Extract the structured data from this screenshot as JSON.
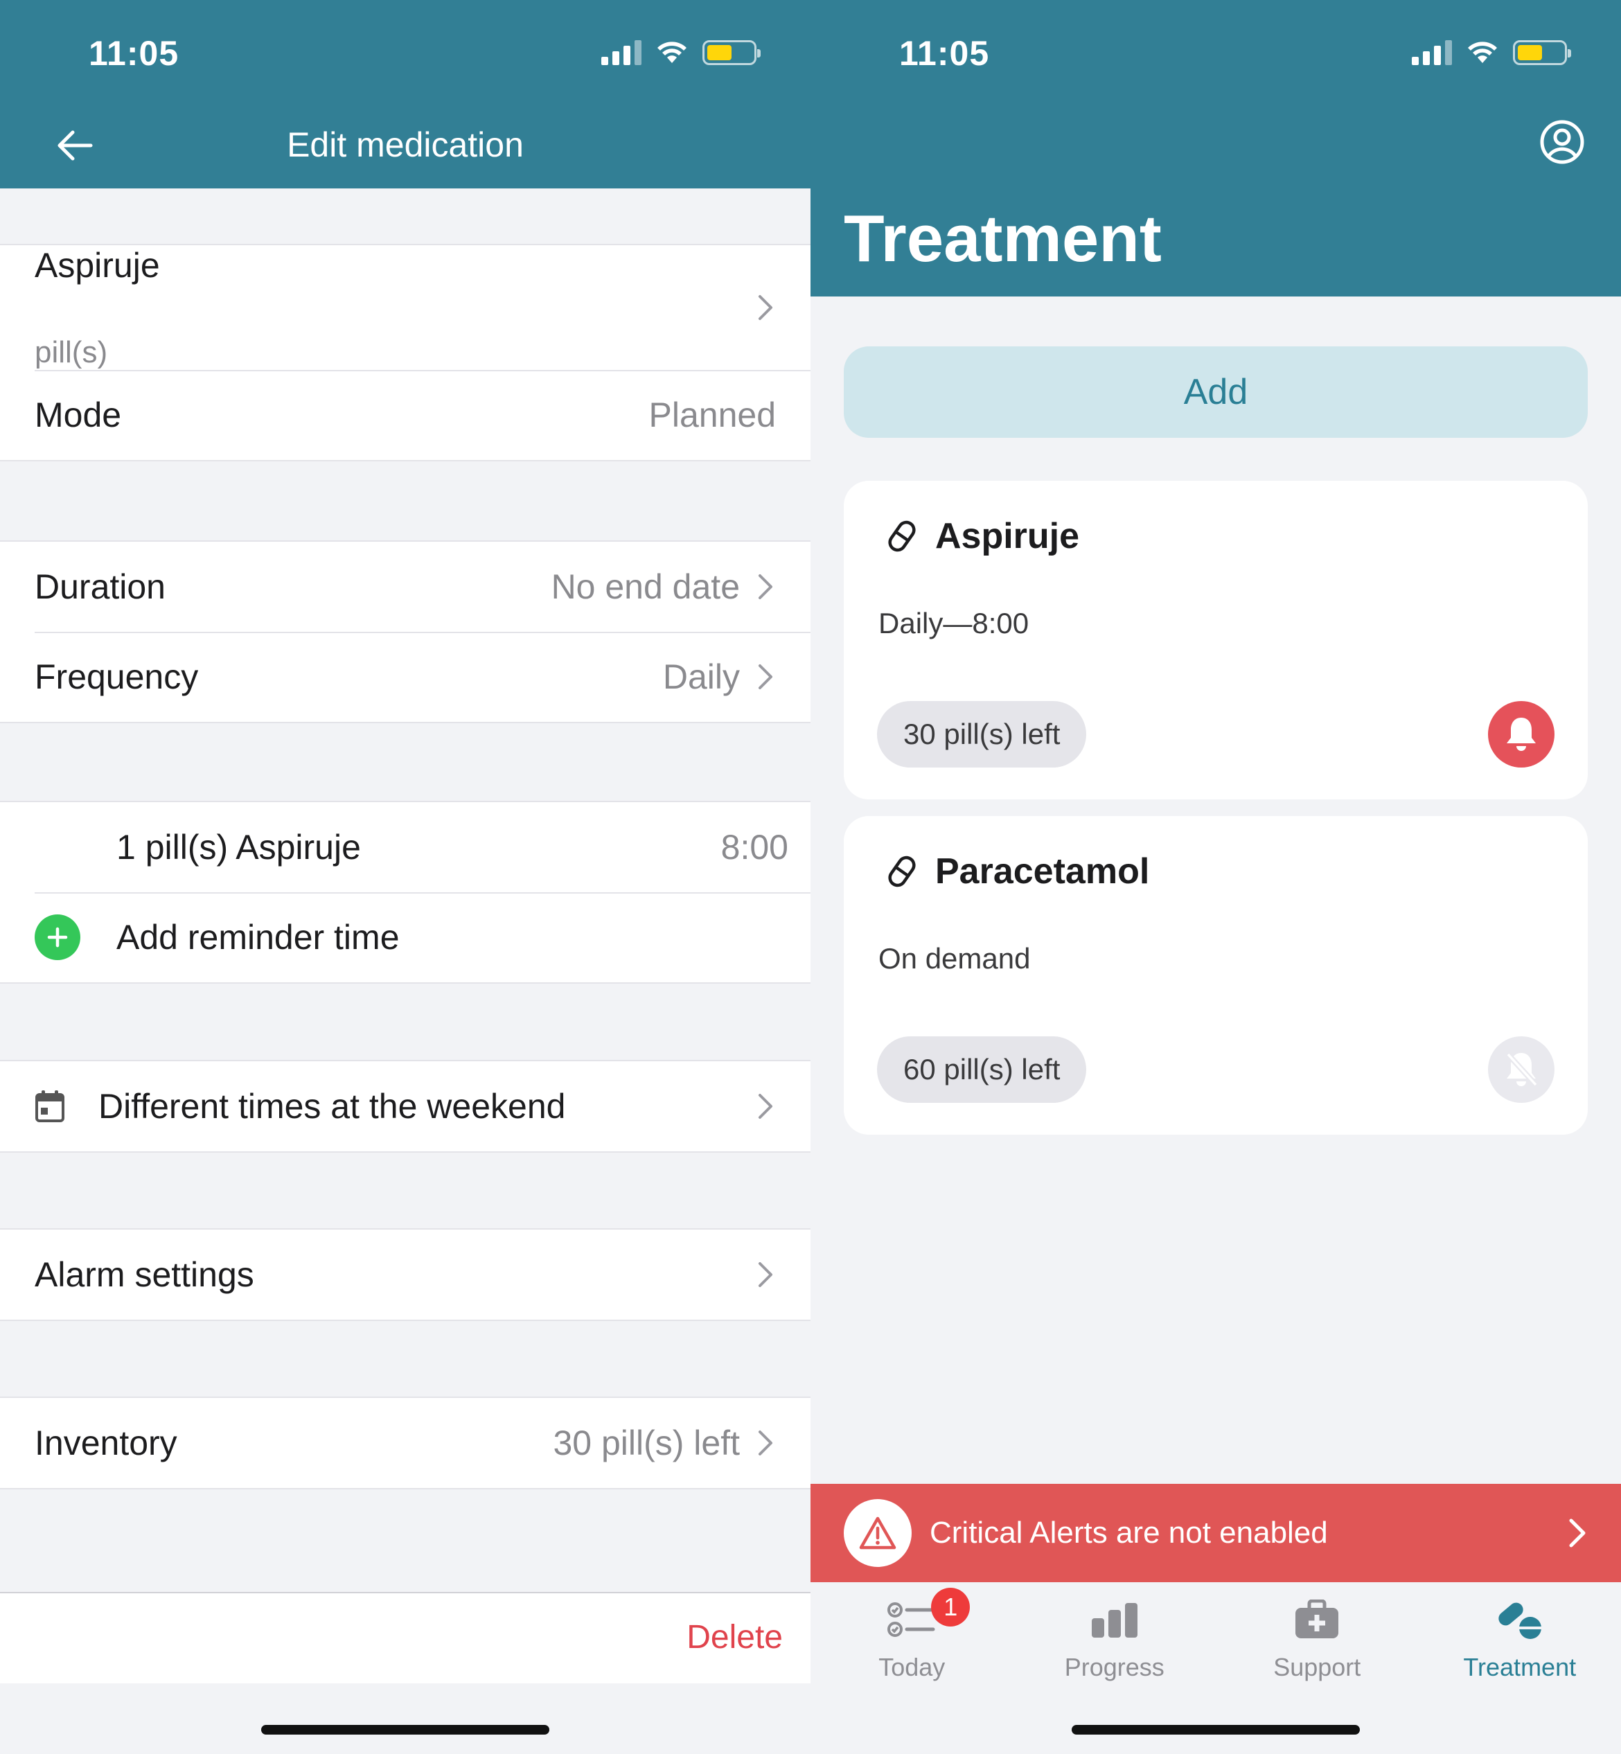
{
  "status_bar": {
    "time": "11:05"
  },
  "edit_screen": {
    "title": "Edit medication",
    "medication": {
      "name": "Aspiruje",
      "unit": "pill(s)"
    },
    "mode": {
      "label": "Mode",
      "value": "Planned"
    },
    "duration": {
      "label": "Duration",
      "value": "No end date"
    },
    "frequency": {
      "label": "Frequency",
      "value": "Daily"
    },
    "reminder": {
      "label": "1 pill(s) Aspiruje",
      "time": "8:00"
    },
    "add_reminder_label": "Add reminder time",
    "weekend_label": "Different times at the weekend",
    "alarm_settings_label": "Alarm settings",
    "inventory": {
      "label": "Inventory",
      "value": "30 pill(s) left"
    },
    "delete_label": "Delete"
  },
  "treatment_screen": {
    "title": "Treatment",
    "add_label": "Add",
    "medications": [
      {
        "name": "Aspiruje",
        "schedule": "Daily—8:00",
        "inventory": "30 pill(s) left",
        "reminder_on": true
      },
      {
        "name": "Paracetamol",
        "schedule": "On demand",
        "inventory": "60 pill(s) left",
        "reminder_on": false
      }
    ],
    "alert": {
      "text": "Critical Alerts are not enabled"
    },
    "tabs": [
      {
        "label": "Today",
        "icon": "checklist-icon",
        "badge": "1"
      },
      {
        "label": "Progress",
        "icon": "bar-chart-icon"
      },
      {
        "label": "Support",
        "icon": "medical-kit-icon"
      },
      {
        "label": "Treatment",
        "icon": "pills-icon",
        "active": true
      }
    ]
  },
  "colors": {
    "header": "#327f95",
    "accent": "#2a7f95",
    "danger": "#e05656",
    "delete": "#e0434c",
    "success": "#34c759",
    "background": "#f2f3f6"
  }
}
